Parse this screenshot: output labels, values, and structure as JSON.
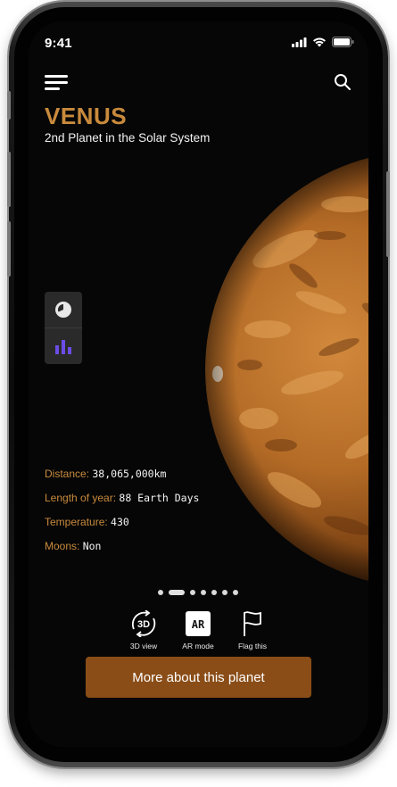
{
  "status_bar": {
    "time": "9:41"
  },
  "planet": {
    "name": "VENUS",
    "subtitle": "2nd Planet in the Solar System"
  },
  "stats": [
    {
      "label": "Distance:",
      "value": "38,065,000km"
    },
    {
      "label": "Length of year:",
      "value": "88 Earth Days"
    },
    {
      "label": "Temperature:",
      "value": "430"
    },
    {
      "label": "Moons:",
      "value": "Non"
    }
  ],
  "pager": {
    "count": 7,
    "active_index": 1
  },
  "actions": [
    {
      "label": "3D view",
      "icon": "3d-rotate-icon"
    },
    {
      "label": "AR mode",
      "icon": "ar-icon"
    },
    {
      "label": "Flag this",
      "icon": "flag-icon"
    }
  ],
  "cta": {
    "label": "More about this planet"
  },
  "colors": {
    "accent": "#c88a3c",
    "button": "#8a4d17",
    "chart_icon": "#6b4de6"
  }
}
